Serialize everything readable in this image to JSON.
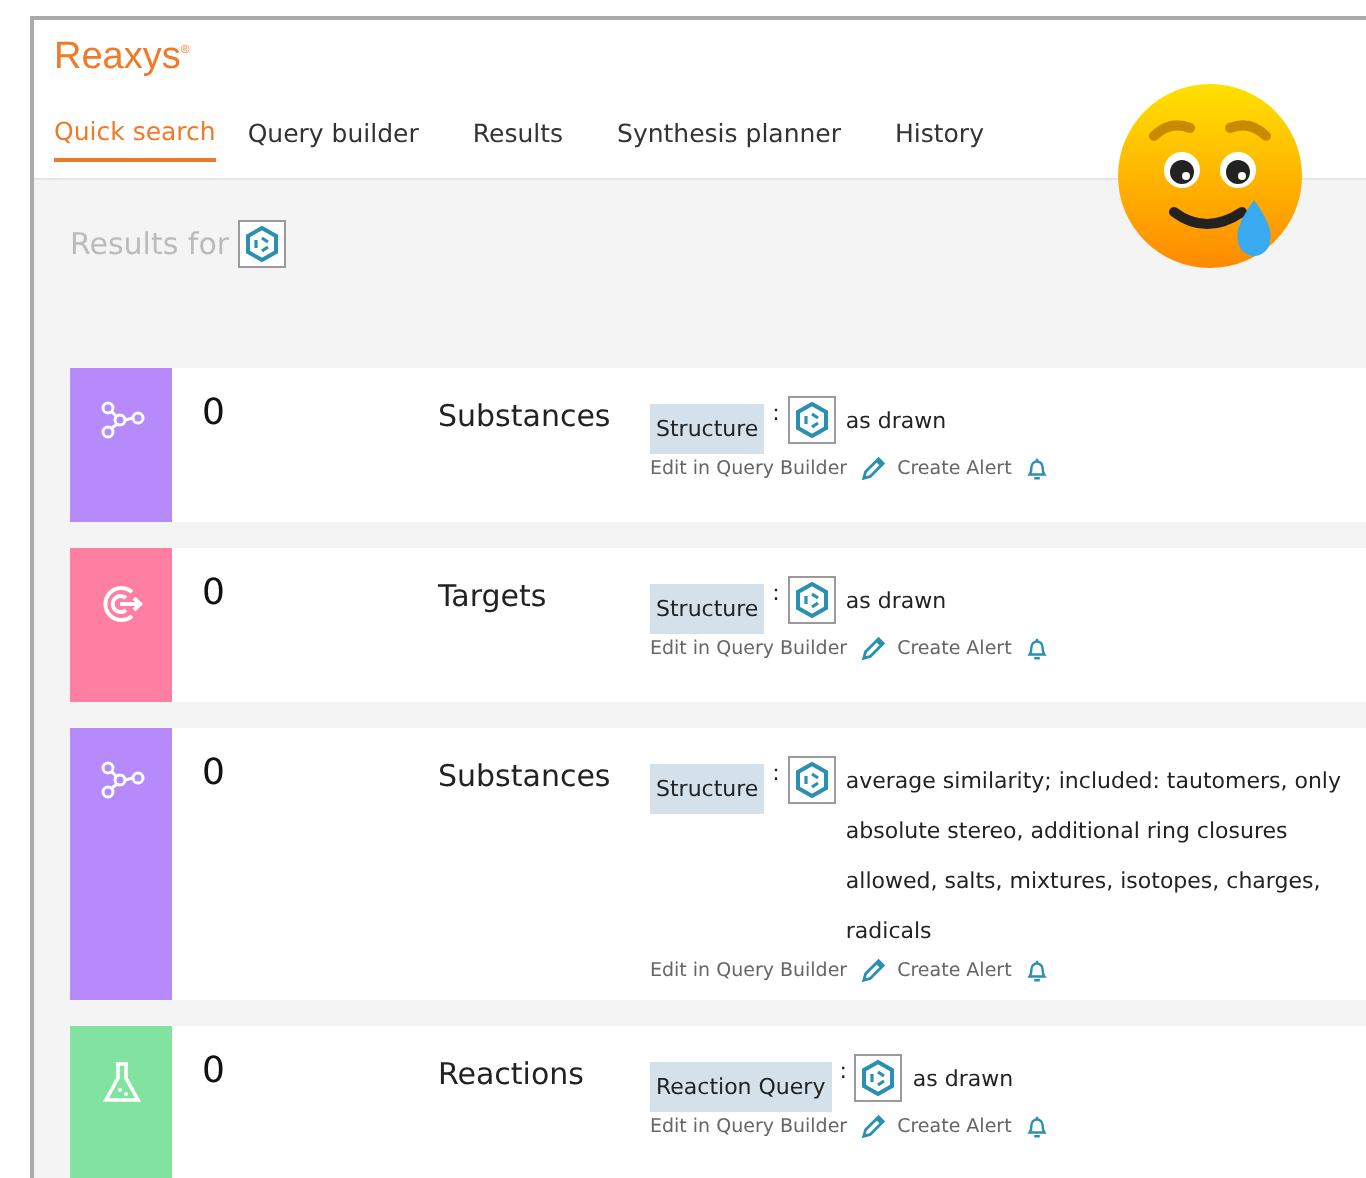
{
  "brand": "Reaxys$^{®}$",
  "tabs": [
    {
      "label": "Quick search",
      "selected": true
    },
    {
      "label": "Query builder",
      "selected": false
    },
    {
      "label": "Results",
      "selected": false
    },
    {
      "label": "Synthesis planner",
      "selected": false
    },
    {
      "label": "History",
      "selected": false
    }
  ],
  "results_for": "Results for",
  "results": [
    {
      "kind": "substance",
      "color": "#b68afa",
      "count": "0",
      "title": "Substances",
      "query_type": "Structure",
      "separator": ":",
      "description": "as drawn",
      "edit": "Edit in Query Builder",
      "alert": "Create Alert"
    },
    {
      "kind": "target",
      "color": "#fe7fa1",
      "count": "0",
      "title": "Targets",
      "query_type": "Structure",
      "separator": ":",
      "description": "as drawn",
      "edit": "Edit in Query Builder",
      "alert": "Create Alert"
    },
    {
      "kind": "substance",
      "color": "#b68afa",
      "count": "0",
      "title": "Substances",
      "query_type": "Structure",
      "separator": ":",
      "description": "average similarity; included: tautomers, only absolute stereo, additional ring closures allowed, salts, mixtures, isotopes, charges, radicals",
      "edit": "Edit in Query Builder",
      "alert": "Create Alert"
    },
    {
      "kind": "reaction",
      "color": "#82e3a0",
      "count": "0",
      "title": "Reactions",
      "query_type": "Reaction Query",
      "separator": ":",
      "description": "as drawn",
      "edit": "Edit in Query Builder",
      "alert": "Create Alert"
    }
  ]
}
